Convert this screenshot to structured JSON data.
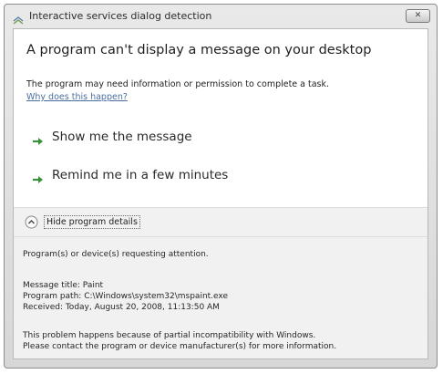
{
  "window": {
    "title": "Interactive services dialog detection",
    "close_glyph": "✕"
  },
  "dialog": {
    "main_instruction": "A program can't display a message on your desktop",
    "content": "The program may need information or permission to complete a task.",
    "help_link": "Why does this happen?",
    "commands": [
      {
        "label": "Show me the message",
        "icon": "arrow-icon"
      },
      {
        "label": "Remind me in a few minutes",
        "icon": "arrow-icon"
      }
    ],
    "expando": {
      "label": "Hide program details",
      "icon": "chevron-up-icon"
    },
    "details": {
      "requesting": "Program(s) or device(s) requesting attention.",
      "message_title": "Message title:  Paint",
      "program_path": "Program path:  C:\\Windows\\system32\\mspaint.exe",
      "received": "Received:  Today, August 20, 2008, 11:13:50 AM",
      "footer_line1": "This problem happens because of partial incompatibility with Windows.",
      "footer_line2": "Please contact the program or device manufacturer(s) for more information."
    }
  },
  "colors": {
    "link": "#4a6ea0",
    "command_arrow": "#3a8f3a",
    "frame": "#d9d9d9"
  }
}
